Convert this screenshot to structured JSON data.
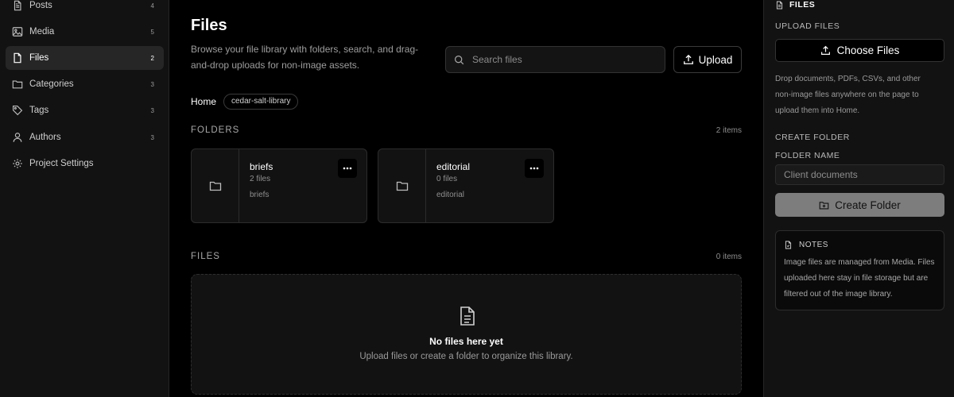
{
  "sidebar": {
    "items": [
      {
        "label": "Posts",
        "count": "4",
        "icon": "document-icon"
      },
      {
        "label": "Media",
        "count": "5",
        "icon": "image-icon"
      },
      {
        "label": "Files",
        "count": "2",
        "icon": "file-icon",
        "active": true
      },
      {
        "label": "Categories",
        "count": "3",
        "icon": "folder-icon"
      },
      {
        "label": "Tags",
        "count": "3",
        "icon": "tag-icon"
      },
      {
        "label": "Authors",
        "count": "3",
        "icon": "user-icon"
      },
      {
        "label": "Project Settings",
        "count": "",
        "icon": "gear-icon"
      }
    ]
  },
  "main": {
    "title": "Files",
    "description": "Browse your file library with folders, search, and drag-and-drop uploads for non-image assets.",
    "search_placeholder": "Search files",
    "upload_label": "Upload",
    "breadcrumb": {
      "home": "Home",
      "current": "cedar-salt-library"
    },
    "folders_section": {
      "title": "FOLDERS",
      "count": "2 items"
    },
    "folders": [
      {
        "name": "briefs",
        "meta": "2 files",
        "slug": "briefs"
      },
      {
        "name": "editorial",
        "meta": "0 files",
        "slug": "editorial"
      }
    ],
    "files_section": {
      "title": "FILES",
      "count": "0 items"
    },
    "empty": {
      "title": "No files here yet",
      "subtitle": "Upload files or create a folder to organize this library."
    }
  },
  "panel": {
    "heading": "FILES",
    "upload_label": "UPLOAD FILES",
    "choose_label": "Choose Files",
    "upload_help": "Drop documents, PDFs, CSVs, and other non-image files anywhere on the page to upload them into Home.",
    "create_label": "CREATE FOLDER",
    "folder_name_label": "FOLDER NAME",
    "folder_name_placeholder": "Client documents",
    "create_button": "Create Folder",
    "notes_title": "NOTES",
    "notes_text": "Image files are managed from Media. Files uploaded here stay in file storage but are filtered out of the image library."
  },
  "colors": {
    "background": "#000000",
    "panel": "#121212",
    "accent": "#7d7d7d"
  }
}
